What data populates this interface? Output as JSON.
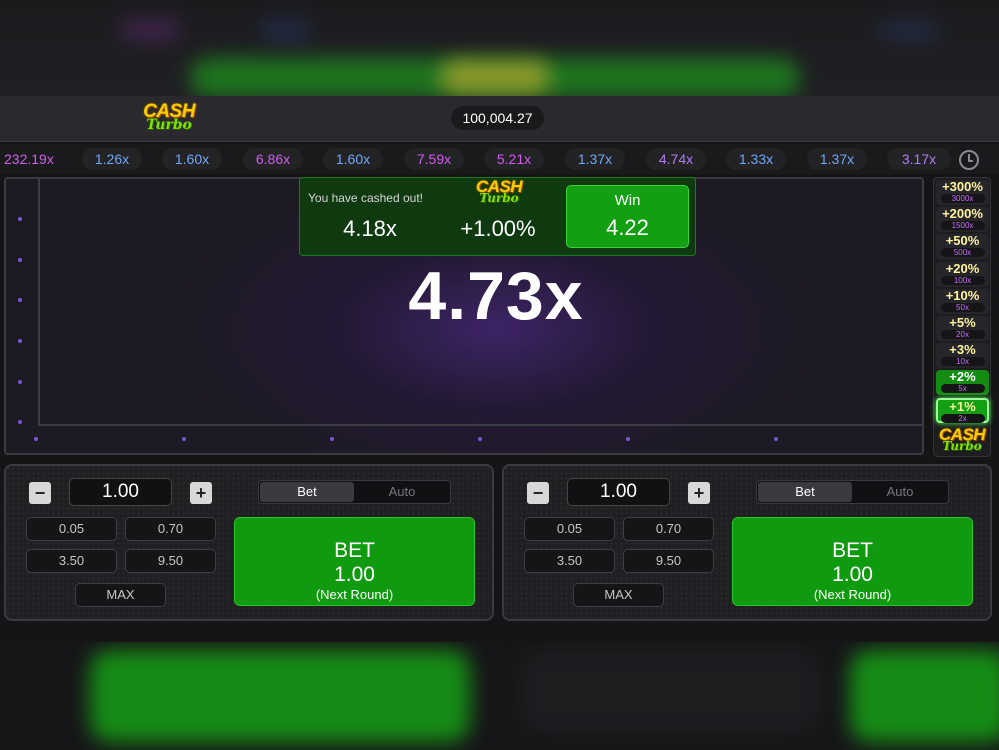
{
  "header": {
    "logo_top": "CASH",
    "logo_bottom": "Turbo",
    "balance": "100,004.27"
  },
  "history": [
    {
      "value": "232.19x",
      "color": "#d05cf0"
    },
    {
      "value": "1.26x",
      "color": "#6fa8f5"
    },
    {
      "value": "1.60x",
      "color": "#6fa8f5"
    },
    {
      "value": "6.86x",
      "color": "#d05cf0"
    },
    {
      "value": "1.60x",
      "color": "#6fa8f5"
    },
    {
      "value": "7.59x",
      "color": "#d05cf0"
    },
    {
      "value": "5.21x",
      "color": "#d05cf0"
    },
    {
      "value": "1.37x",
      "color": "#6fa8f5"
    },
    {
      "value": "4.74x",
      "color": "#b07cf5"
    },
    {
      "value": "1.33x",
      "color": "#6fa8f5"
    },
    {
      "value": "1.37x",
      "color": "#6fa8f5"
    },
    {
      "value": "3.17x",
      "color": "#b07cf5"
    }
  ],
  "game": {
    "multiplier": "4.73x",
    "cashout": {
      "message": "You have cashed out!",
      "multiplier": "4.18x",
      "bonus": "+1.00%",
      "win_label": "Win",
      "win_value": "4.22"
    }
  },
  "ladder": [
    {
      "pct": "+300%",
      "sub": "3000x",
      "state": "idle"
    },
    {
      "pct": "+200%",
      "sub": "1500x",
      "state": "idle"
    },
    {
      "pct": "+50%",
      "sub": "500x",
      "state": "idle"
    },
    {
      "pct": "+20%",
      "sub": "100x",
      "state": "idle"
    },
    {
      "pct": "+10%",
      "sub": "50x",
      "state": "idle"
    },
    {
      "pct": "+5%",
      "sub": "20x",
      "state": "idle"
    },
    {
      "pct": "+3%",
      "sub": "10x",
      "state": "idle"
    },
    {
      "pct": "+2%",
      "sub": "5x",
      "state": "active"
    },
    {
      "pct": "+1%",
      "sub": "2x",
      "state": "current"
    }
  ],
  "panels": [
    {
      "amount": "1.00",
      "minus": "−",
      "plus": "+",
      "tab_bet": "Bet",
      "tab_auto": "Auto",
      "chips": [
        "0.05",
        "0.70",
        "3.50",
        "9.50"
      ],
      "max": "MAX",
      "bet_label": "BET",
      "bet_amount": "1.00",
      "bet_note": "(Next Round)"
    },
    {
      "amount": "1.00",
      "minus": "−",
      "plus": "+",
      "tab_bet": "Bet",
      "tab_auto": "Auto",
      "chips": [
        "0.05",
        "0.70",
        "3.50",
        "9.50"
      ],
      "max": "MAX",
      "bet_label": "BET",
      "bet_amount": "1.00",
      "bet_note": "(Next Round)"
    }
  ]
}
